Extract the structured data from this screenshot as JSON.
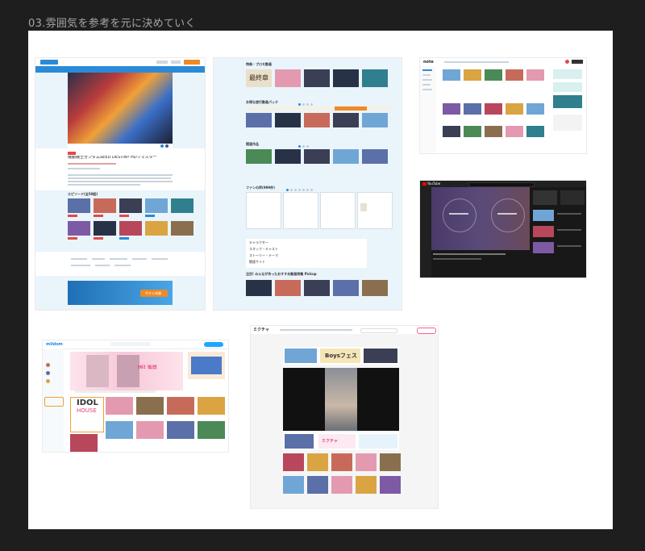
{
  "canvas": {
    "title": "03.雰囲気を参考を元に決めていく",
    "background": "#1e1e1e",
    "board_color": "#ffffff"
  },
  "shot1": {
    "hero_title": "機動戦士ガンダムSEED DESTINY HDリマスター",
    "section_episodes": "エピソード(全50話)",
    "banner_button": "今すぐ体験",
    "accent": "#2b8ad8",
    "cta_color": "#f08a24"
  },
  "shot2": {
    "sections": [
      "特典・プロモ動画",
      "お得な旅行動画パック",
      "関連作品",
      "ファンの声(999件)",
      "注目! みんなが作ったおすすめ動画特集 Pickup"
    ],
    "promo_text": "最終章",
    "link_items": [
      "キャラクター",
      "スタッフ・キャスト",
      "ストーリー・テーマ",
      "関連サイト"
    ]
  },
  "shot3": {
    "logo": "note"
  },
  "shot4": {
    "logo": "YouTube"
  },
  "shot5": {
    "logo": "mildom",
    "banner_text": "Hi! 仙台",
    "idol_text_1": "IDOL",
    "idol_text_2": "HOUSE"
  },
  "shot6": {
    "logo": "ミクチャ",
    "banner_text": "Boysフェス",
    "promo_text": "ミクチャ"
  }
}
